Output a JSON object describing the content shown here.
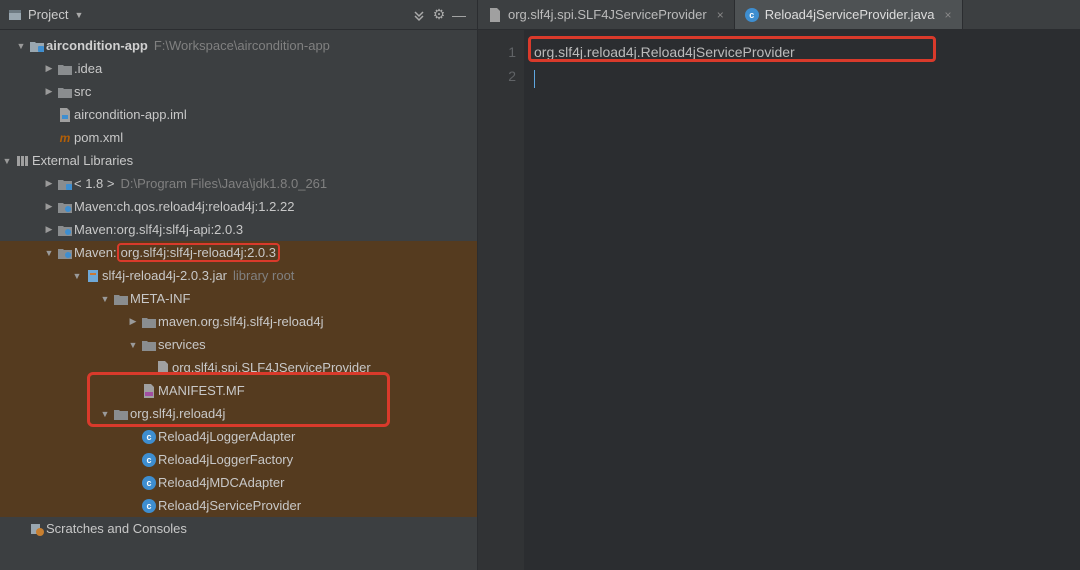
{
  "sidebar": {
    "title": "Project",
    "root": {
      "name": "aircondition-app",
      "path": "F:\\Workspace\\aircondition-app"
    },
    "folders": {
      "idea": ".idea",
      "src": "src"
    },
    "files": {
      "iml": "aircondition-app.iml",
      "pom": "pom.xml"
    },
    "extLib": "External Libraries",
    "jdk": {
      "name": "< 1.8 >",
      "path": "D:\\Program Files\\Java\\jdk1.8.0_261"
    },
    "maven": [
      {
        "prefix": "Maven: ",
        "artifact": "ch.qos.reload4j:reload4j:1.2.22"
      },
      {
        "prefix": "Maven: ",
        "artifact": "org.slf4j:slf4j-api:2.0.3"
      },
      {
        "prefix": "Maven: ",
        "artifact": "org.slf4j:slf4j-reload4j:2.0.3",
        "highlight": true
      }
    ],
    "jar": {
      "name": "slf4j-reload4j-2.0.3.jar",
      "note": "library root"
    },
    "metaInf": "META-INF",
    "mavenMeta": "maven.org.slf4j.slf4j-reload4j",
    "services": "services",
    "spiFile": "org.slf4j.spi.SLF4JServiceProvider",
    "manifest": "MANIFEST.MF",
    "pkg": "org.slf4j.reload4j",
    "classes": [
      "Reload4jLoggerAdapter",
      "Reload4jLoggerFactory",
      "Reload4jMDCAdapter",
      "Reload4jServiceProvider"
    ],
    "scratches": "Scratches and Consoles"
  },
  "tabs": [
    {
      "label": "org.slf4j.spi.SLF4JServiceProvider",
      "kind": "file"
    },
    {
      "label": "Reload4jServiceProvider.java",
      "kind": "class",
      "active": true
    }
  ],
  "code": {
    "lines": [
      "1",
      "2"
    ],
    "text": "org.slf4j.reload4j.Reload4jServiceProvider"
  }
}
